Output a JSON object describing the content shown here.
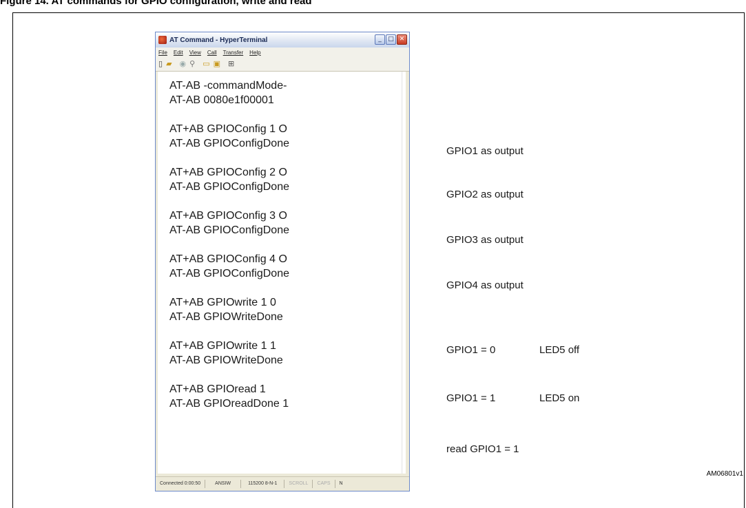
{
  "figure": {
    "title": "Figure 14.  AT commands for GPIO configuration, write and read",
    "ref": "AM06801v1"
  },
  "window": {
    "title": "AT Command - HyperTerminal",
    "minimize": "_",
    "maximize": "□",
    "close": "✕",
    "menu": [
      "File",
      "Edit",
      "View",
      "Call",
      "Transfer",
      "Help"
    ],
    "toolbar_icons": [
      "new-icon",
      "open-icon",
      "disconnect-icon",
      "properties-icon",
      "send-icon",
      "receive-icon",
      "settings-icon"
    ]
  },
  "terminal": {
    "lines": [
      [
        "AT-AB -commandMode-",
        "AT-AB 0080e1f00001"
      ],
      [
        "AT+AB GPIOConfig 1 O",
        "AT-AB  GPIOConfigDone"
      ],
      [
        "AT+AB GPIOConfig 2 O",
        "AT-AB  GPIOConfigDone"
      ],
      [
        "AT+AB GPIOConfig 3 O",
        "AT-AB  GPIOConfigDone"
      ],
      [
        "AT+AB GPIOConfig 4 O",
        "AT-AB  GPIOConfigDone"
      ],
      [
        "AT+AB GPIOwrite 1 0",
        "AT-AB GPIOWriteDone"
      ],
      [
        "AT+AB GPIOwrite 1 1",
        "AT-AB GPIOWriteDone"
      ],
      [
        "AT+AB GPIOread 1",
        "AT-AB GPIOreadDone 1"
      ]
    ]
  },
  "status": {
    "connected": "Connected 0:00:50",
    "emulation": "ANSIW",
    "settings": "115200 8-N-1",
    "scroll": "SCROLL",
    "caps": "CAPS",
    "num": "N"
  },
  "annotations": {
    "gpio1": "GPIO1 as output",
    "gpio2": "GPIO2 as output",
    "gpio3": "GPIO3 as output",
    "gpio4": "GPIO4 as output",
    "write0": "GPIO1 = 0",
    "led_off": "LED5 off",
    "write1": "GPIO1 = 1",
    "led_on": "LED5 on",
    "read": "read GPIO1 = 1"
  }
}
